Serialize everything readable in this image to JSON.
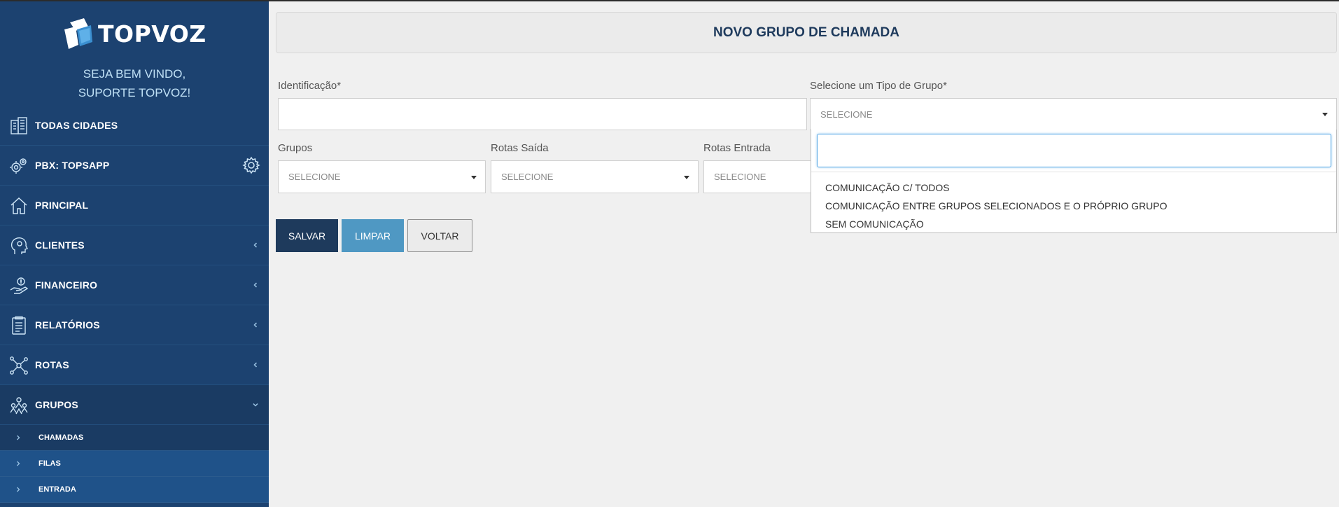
{
  "brand": {
    "name": "TOPVOZ",
    "welcome_line1": "SEJA BEM VINDO,",
    "welcome_line2": "SUPORTE TOPVOZ!"
  },
  "colors": {
    "sidebar": "#1c4270",
    "primary_button": "#1e3a5c",
    "secondary_button": "#4f98c3",
    "accent": "#5aa9e6"
  },
  "sidebar": {
    "items": [
      {
        "label": "TODAS CIDADES",
        "icon": "buildings-icon"
      },
      {
        "label": "PBX: TOPSAPP",
        "icon": "gears-icon",
        "action_icon": "gear-icon"
      },
      {
        "label": "PRINCIPAL",
        "icon": "home-icon"
      },
      {
        "label": "CLIENTES",
        "icon": "user-head-icon",
        "chevron": "chevron-left-icon"
      },
      {
        "label": "FINANCEIRO",
        "icon": "hand-money-icon",
        "chevron": "chevron-left-icon"
      },
      {
        "label": "RELATÓRIOS",
        "icon": "report-icon",
        "chevron": "chevron-left-icon"
      },
      {
        "label": "ROTAS",
        "icon": "network-icon",
        "chevron": "chevron-left-icon"
      },
      {
        "label": "GRUPOS",
        "icon": "group-icon",
        "chevron": "chevron-down-icon"
      }
    ],
    "subitems": [
      {
        "label": "CHAMADAS"
      },
      {
        "label": "FILAS"
      },
      {
        "label": "ENTRADA"
      }
    ]
  },
  "page": {
    "title": "NOVO GRUPO DE CHAMADA"
  },
  "form": {
    "identificacao": {
      "label": "Identificação*",
      "value": ""
    },
    "tipo_grupo": {
      "label": "Selecione um Tipo de Grupo*",
      "value": "SELECIONE"
    },
    "grupos": {
      "label": "Grupos",
      "value": "SELECIONE"
    },
    "rotas_saida": {
      "label": "Rotas Saída",
      "value": "SELECIONE"
    },
    "rotas_entrada": {
      "label": "Rotas Entrada",
      "value": "SELECIONE"
    }
  },
  "dropdown": {
    "search_value": "",
    "options": [
      "COMUNICAÇÃO C/ TODOS",
      "COMUNICAÇÃO ENTRE GRUPOS SELECIONADOS E O PRÓPRIO GRUPO",
      "SEM COMUNICAÇÃO"
    ]
  },
  "buttons": {
    "save": "SALVAR",
    "clear": "LIMPAR",
    "back": "VOLTAR"
  }
}
